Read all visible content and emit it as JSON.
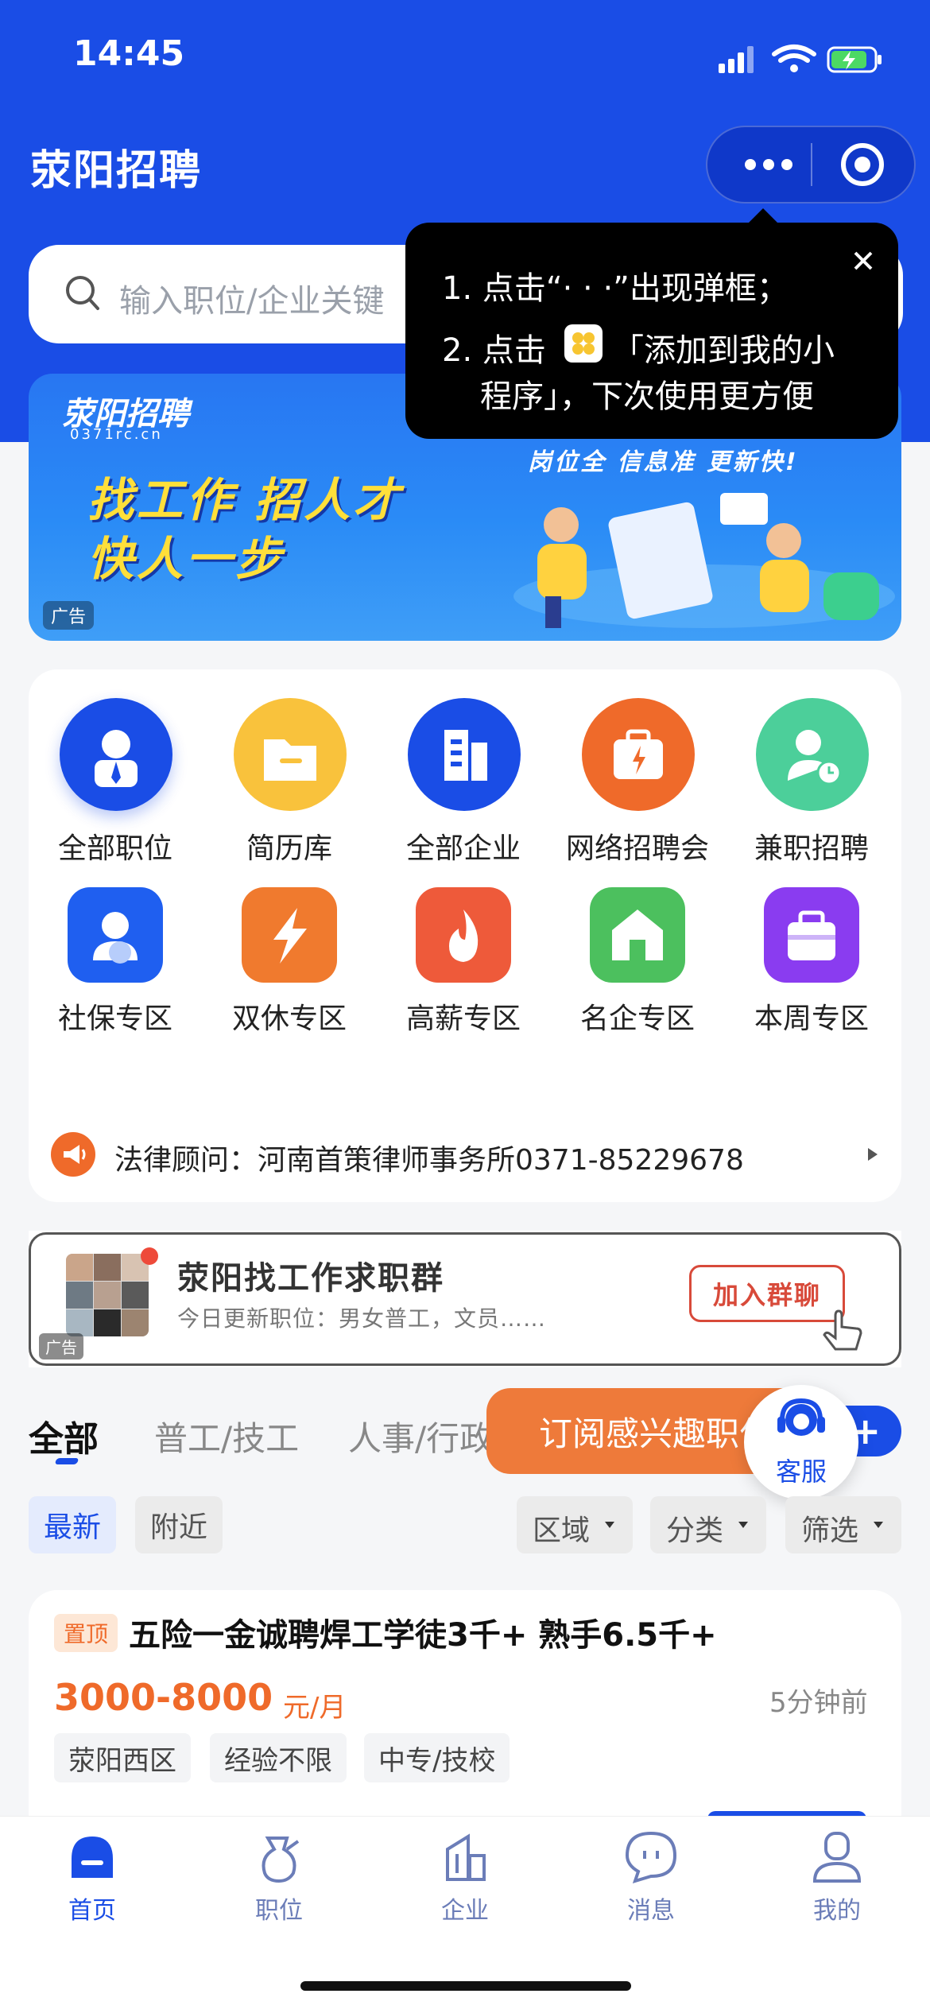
{
  "status_bar": {
    "time": "14:45"
  },
  "header": {
    "title": "荥阳招聘"
  },
  "search": {
    "placeholder": "输入职位/企业关键"
  },
  "tooltip": {
    "line1": "1. 点击“· · ·”出现弹框；",
    "line2_a": "2. 点击",
    "line2_b": "「添加到我的小",
    "line3": "程序」，下次使用更方便"
  },
  "banner": {
    "logo_text": "荥阳招聘",
    "logo_domain": "0371rc.cn",
    "headline1": "找工作 招人才",
    "headline2": "快人一步",
    "slogan": "岗位全 信息准 更新快!",
    "ad_label": "广告"
  },
  "categories": [
    {
      "label": "全部职位",
      "icon": "user-badge-icon"
    },
    {
      "label": "简历库",
      "icon": "folder-icon"
    },
    {
      "label": "全部企业",
      "icon": "building-icon"
    },
    {
      "label": "网络招聘会",
      "icon": "briefcase-bolt-icon"
    },
    {
      "label": "兼职招聘",
      "icon": "user-clock-icon"
    }
  ],
  "zones": [
    {
      "label": "社保专区",
      "icon": "person-icon"
    },
    {
      "label": "双休专区",
      "icon": "lightning-icon"
    },
    {
      "label": "高薪专区",
      "icon": "flame-icon"
    },
    {
      "label": "名企专区",
      "icon": "house-icon"
    },
    {
      "label": "本周专区",
      "icon": "bag-icon"
    }
  ],
  "notice": {
    "text": "法律顾问：河南首策律师事务所0371-85229678"
  },
  "group_ad": {
    "title": "荥阳找工作求职群",
    "subtitle": "今日更新职位：男女普工，文员……",
    "button": "加入群聊",
    "ad_label": "广告"
  },
  "tabs": [
    {
      "label": "全部"
    },
    {
      "label": "普工/技工"
    },
    {
      "label": "人事/行政/后"
    }
  ],
  "subscribe": {
    "label": "订阅感兴趣职位",
    "plus": "+"
  },
  "support": {
    "label": "客服"
  },
  "filters": {
    "sort": [
      {
        "label": "最新"
      },
      {
        "label": "附近"
      }
    ],
    "dropdowns": [
      {
        "label": "区域"
      },
      {
        "label": "分类"
      },
      {
        "label": "筛选"
      }
    ]
  },
  "job": {
    "badge": "置顶",
    "title": "五险一金诚聘焊工学徒3千+ 熟手6.5千+",
    "salary": "3000-8000",
    "salary_unit": "元/月",
    "time": "5分钟前",
    "tags": [
      "荥阳西区",
      "经验不限",
      "中专/技校"
    ]
  },
  "tabbar": [
    {
      "label": "首页",
      "icon": "home-icon"
    },
    {
      "label": "职位",
      "icon": "job-icon"
    },
    {
      "label": "企业",
      "icon": "company-icon"
    },
    {
      "label": "消息",
      "icon": "message-icon"
    },
    {
      "label": "我的",
      "icon": "profile-icon"
    }
  ],
  "colors": {
    "brand": "#1a4de6",
    "accent": "#ee6a2c",
    "active_tab": "#1a4de6"
  }
}
